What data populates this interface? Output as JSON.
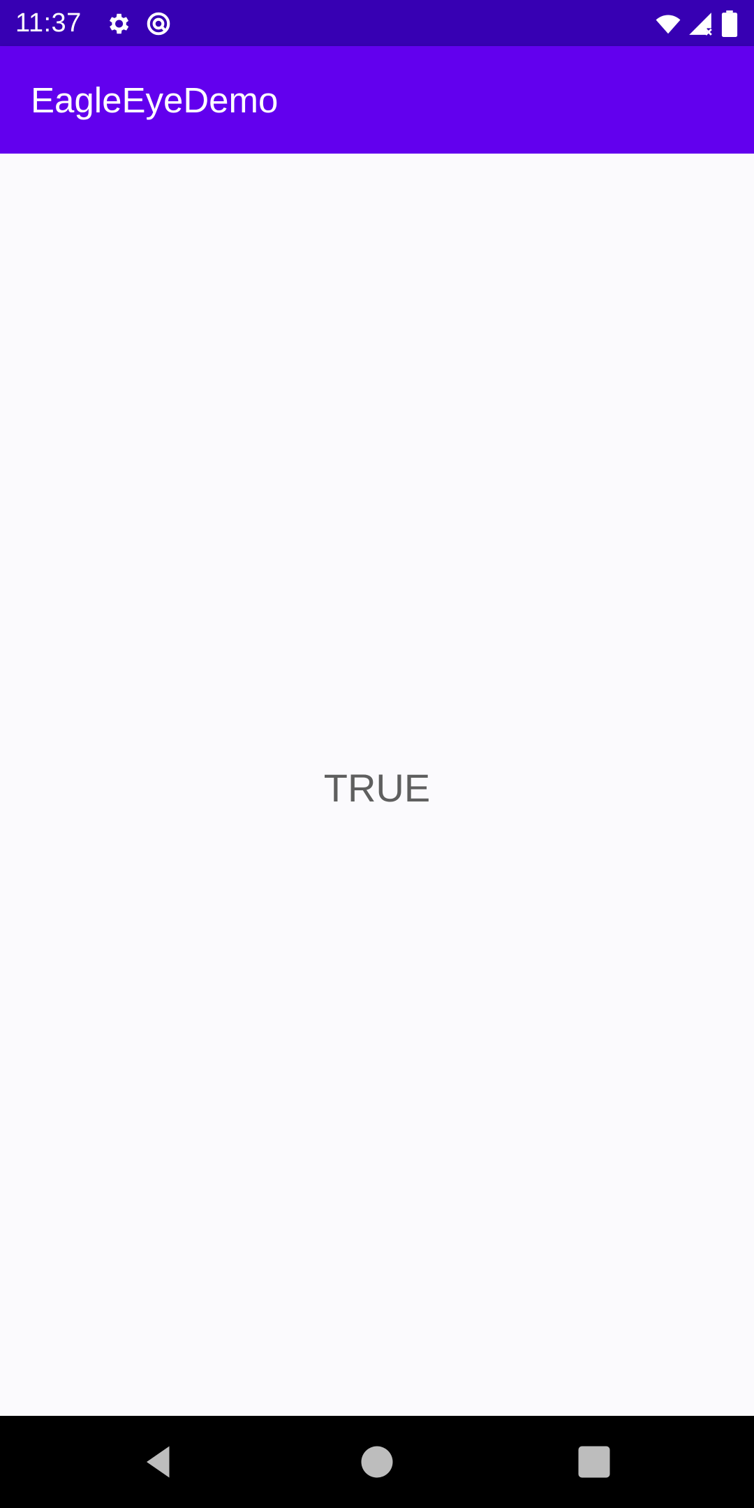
{
  "status_bar": {
    "time": "11:37",
    "icons": [
      "gear-icon",
      "sync-icon",
      "wifi-icon",
      "signal-icon",
      "battery-icon"
    ]
  },
  "app_bar": {
    "title": "EagleEyeDemo",
    "background": "#6200ee"
  },
  "content": {
    "result_text": "TRUE"
  },
  "navigation": {
    "icons": [
      "back-icon",
      "home-icon",
      "recents-icon"
    ]
  },
  "colors": {
    "status_bar": "#3700b3",
    "app_bar": "#6200ee",
    "background": "#fbfafd",
    "text": "#5f5f5f"
  }
}
